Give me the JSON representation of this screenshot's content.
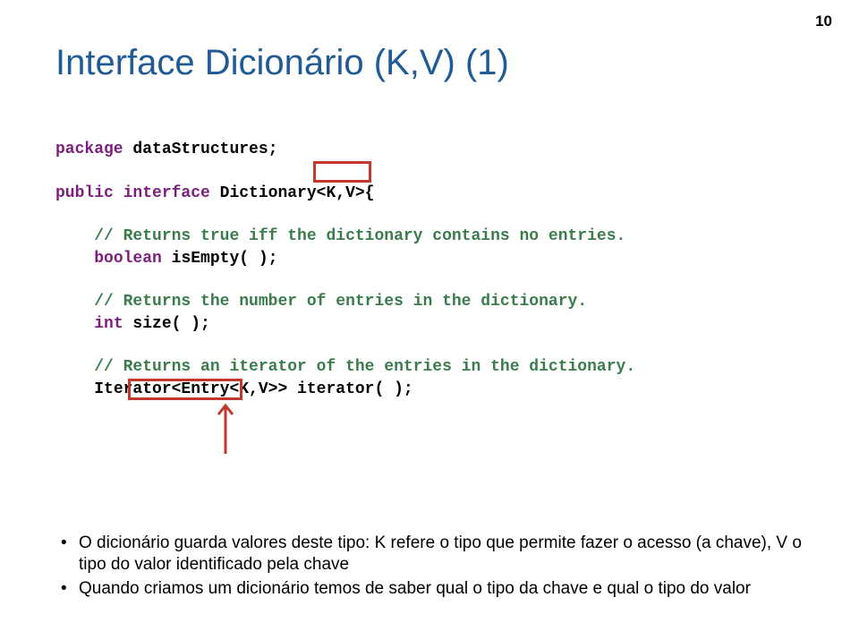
{
  "page_number": "10",
  "title": "Interface Dicionário (K,V) (1)",
  "code": {
    "l1_kw": "package",
    "l1_rest": " dataStructures;",
    "l2_kw1": "public",
    "l2_kw2": "interface",
    "l2_rest": " Dictionary<K,V>{",
    "c1": "// Returns true iff the dictionary contains no entries.",
    "l3_kw": "boolean",
    "l3_rest": " isEmpty( );",
    "c2": "// Returns the number of entries in the dictionary.",
    "l4_kw": "int",
    "l4_rest": " size( );",
    "c3": "// Returns an iterator of the entries in the dictionary.",
    "l5": "Iterator<Entry<K,V>> iterator( );"
  },
  "bullets": [
    "O dicionário guarda valores deste tipo:  K refere o tipo que permite fazer o acesso (a chave), V o tipo do valor identificado pela chave",
    "Quando criamos um dicionário temos de saber qual o tipo da chave e qual o tipo do valor"
  ]
}
